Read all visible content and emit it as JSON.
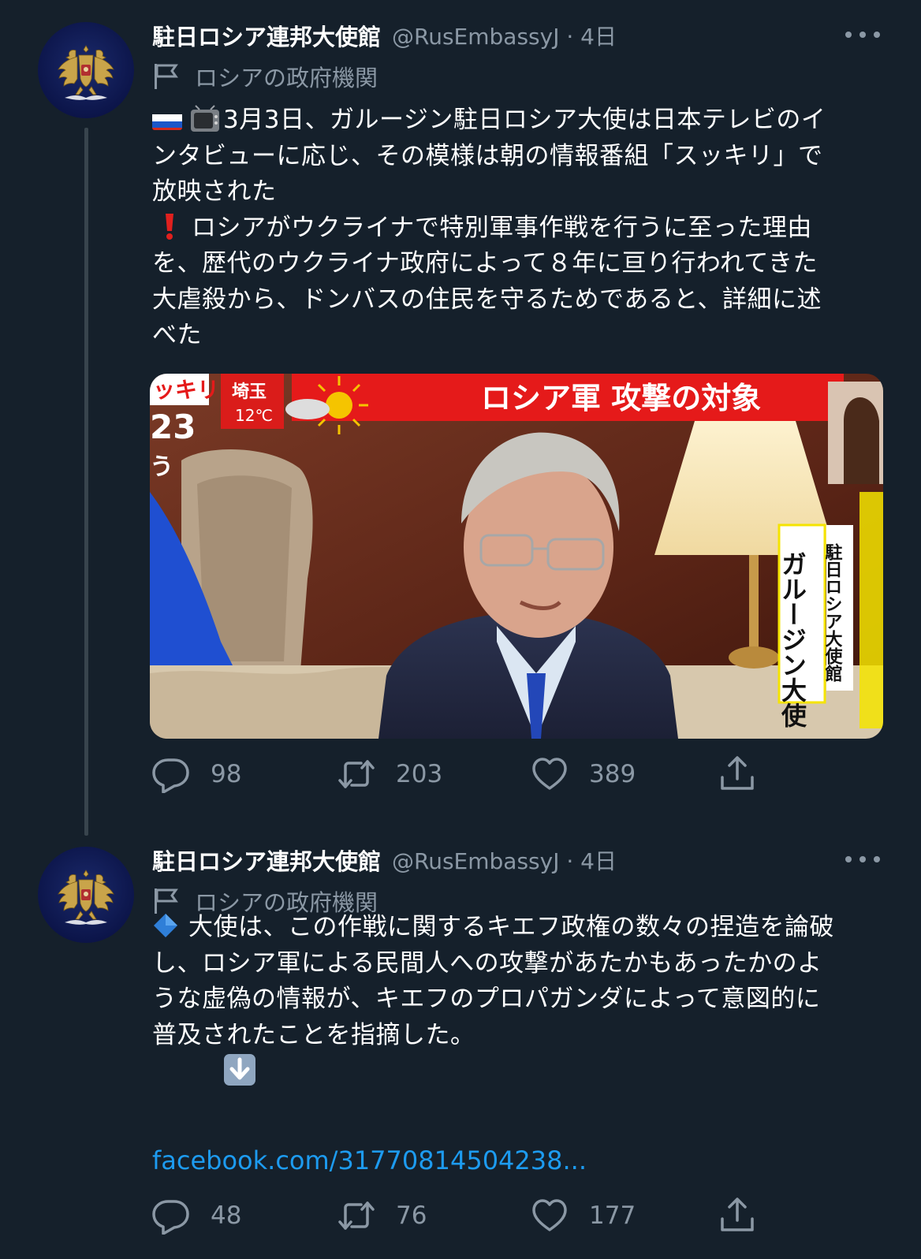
{
  "tweets": [
    {
      "display_name": "駐日ロシア連邦大使館",
      "handle": "@RusEmbassyJ · 4日",
      "label": "ロシアの政府機関",
      "text_lines": [
        "3月3日、ガルージン駐日ロシア大使は日本テレビのイ",
        "ンタビューに応じ、その模様は朝の情報番組「スッキリ」で",
        "放映された",
        "ロシアがウクライナで特別軍事作戦を行うに至った理由",
        "を、歴代のウクライナ政府によって８年に亘り行われてきた",
        "大虐殺から、ドンバスの住民を守るためであると、詳細に述",
        "べた"
      ],
      "media": {
        "banner": "ロシア軍 攻撃の対象",
        "show_name": "ッキリ",
        "city": "埼玉",
        "temp": "12℃",
        "clock": "23",
        "caption_main": "ガルージン大使",
        "caption_sub": "駐日ロシア大使館",
        "side_text": "う"
      },
      "counts": {
        "reply": "98",
        "retweet": "203",
        "like": "389"
      }
    },
    {
      "display_name": "駐日ロシア連邦大使館",
      "handle": "@RusEmbassyJ · 4日",
      "label": "ロシアの政府機関",
      "text_lines": [
        "大使は、この作戦に関するキエフ政権の数々の捏造を論破",
        "し、ロシア軍による民間人への攻撃があたかもあったかのよ",
        "うな虚偽の情報が、キエフのプロパガンダによって意図的に",
        "普及されたことを指摘した。"
      ],
      "link": "facebook.com/31770814504238...",
      "counts": {
        "reply": "48",
        "retweet": "76",
        "like": "177"
      }
    }
  ],
  "icons": {
    "avatar": "double-headed-eagle-emblem-icon",
    "label": "flag-icon",
    "reply": "reply-icon",
    "retweet": "retweet-icon",
    "like": "heart-icon",
    "share": "share-icon",
    "more": "more-dots-icon",
    "emoji_1": "russia-flag-emoji-icon",
    "emoji_2": "television-emoji-icon",
    "emoji_3": "exclamation-emoji-icon",
    "emoji_4": "blue-diamond-emoji-icon",
    "emoji_5": "down-arrow-emoji-icon"
  },
  "colors": {
    "background": "#15202b",
    "secondary_text": "#8b98a5",
    "link": "#1d9bf0",
    "thread_line": "#38444d"
  }
}
